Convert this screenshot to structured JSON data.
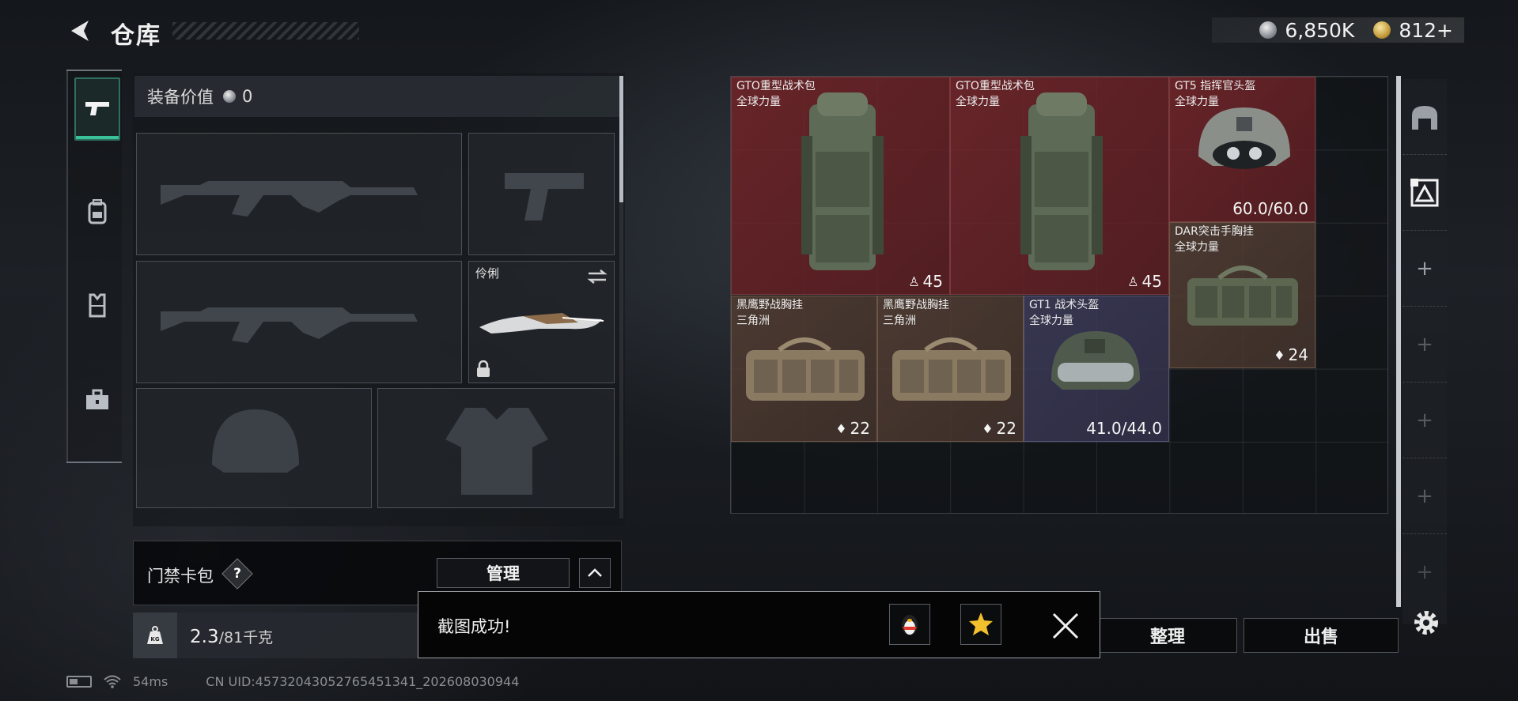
{
  "header": {
    "title": "仓库",
    "currency": [
      {
        "icon": "silver-coin-icon",
        "value": "6,850K"
      },
      {
        "icon": "gold-coin-icon",
        "value": "812+"
      }
    ]
  },
  "left_nav": [
    "pistol-icon",
    "backpack-icon",
    "vest-icon",
    "toolbox-icon"
  ],
  "equipment": {
    "value_label": "装备价值",
    "value": "0",
    "knife_label": "伶俐"
  },
  "keycard": {
    "label": "门禁卡包",
    "help": "?",
    "manage_label": "管理"
  },
  "weight": {
    "current": "2.3",
    "max": "/81千克"
  },
  "status_bar": {
    "ping": "54ms",
    "uid": "CN UID:457320430527654513­41_202608030944"
  },
  "storage_items": [
    {
      "name": "GTO重型战术包",
      "sub": "全球力量",
      "count": "45",
      "rarity": "red"
    },
    {
      "name": "GTO重型战术包",
      "sub": "全球力量",
      "count": "45",
      "rarity": "red"
    },
    {
      "name": "GT5 指挥官头盔",
      "sub": "全球力量",
      "count": "60.0/60.0",
      "rarity": "red"
    },
    {
      "name": "DAR突击手胸挂",
      "sub": "全球力量",
      "count": "24",
      "rarity": "brown"
    },
    {
      "name": "黑鹰野战胸挂",
      "sub": "三角洲",
      "count": "22",
      "rarity": "brown"
    },
    {
      "name": "黑鹰野战胸挂",
      "sub": "三角洲",
      "count": "22",
      "rarity": "brown"
    },
    {
      "name": "GT1 战术头盔",
      "sub": "全球力量",
      "count": "41.0/44.0",
      "rarity": "purple"
    }
  ],
  "actions": {
    "sort_label": "整理",
    "sell_label": "出售"
  },
  "toast": {
    "message": "截图成功!"
  }
}
